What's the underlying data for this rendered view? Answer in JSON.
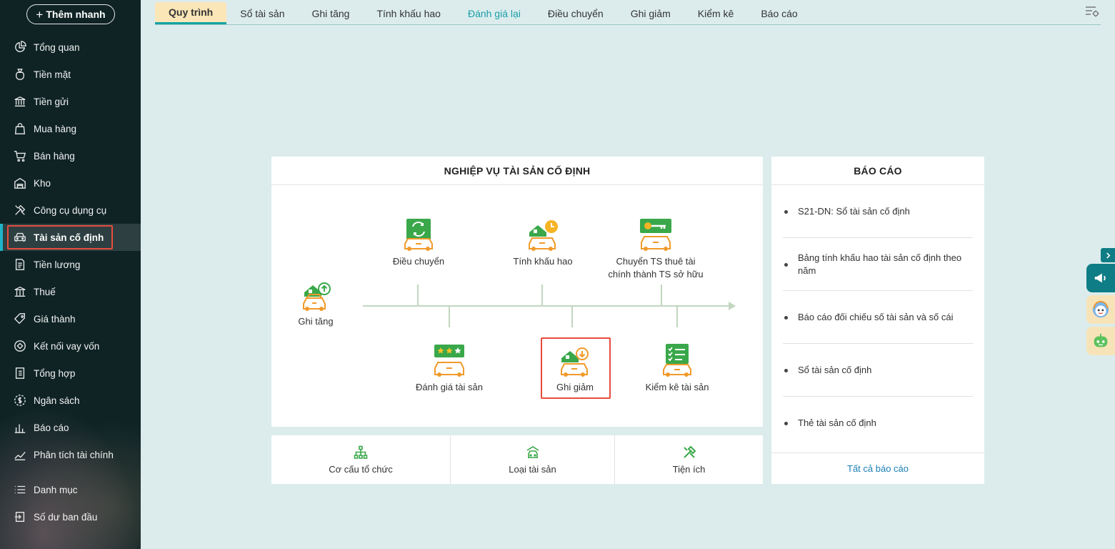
{
  "sidebar": {
    "quick_add": "Thêm nhanh",
    "items": [
      {
        "label": "Tổng quan",
        "icon": "pie-chart-icon"
      },
      {
        "label": "Tiền mặt",
        "icon": "money-bag-icon"
      },
      {
        "label": "Tiền gửi",
        "icon": "bank-icon"
      },
      {
        "label": "Mua hàng",
        "icon": "shopping-bag-icon"
      },
      {
        "label": "Bán hàng",
        "icon": "cart-icon"
      },
      {
        "label": "Kho",
        "icon": "warehouse-icon"
      },
      {
        "label": "Công cụ dụng cụ",
        "icon": "tools-icon"
      },
      {
        "label": "Tài sản cố định",
        "icon": "car-icon",
        "active": true
      },
      {
        "label": "Tiền lương",
        "icon": "payroll-icon"
      },
      {
        "label": "Thuế",
        "icon": "tax-building-icon"
      },
      {
        "label": "Giá thành",
        "icon": "price-tag-icon"
      },
      {
        "label": "Kết nối vay vốn",
        "icon": "loan-link-icon"
      },
      {
        "label": "Tổng hợp",
        "icon": "ledger-icon"
      },
      {
        "label": "Ngân sách",
        "icon": "budget-coin-icon"
      },
      {
        "label": "Báo cáo",
        "icon": "bar-chart-icon"
      },
      {
        "label": "Phân tích tài chính",
        "icon": "trend-line-icon"
      }
    ],
    "bottom_items": [
      {
        "label": "Danh mục",
        "icon": "list-icon"
      },
      {
        "label": "Số dư ban đầu",
        "icon": "opening-balance-icon"
      }
    ]
  },
  "tabs": [
    {
      "label": "Quy trình",
      "active": true
    },
    {
      "label": "Sổ tài sản"
    },
    {
      "label": "Ghi tăng"
    },
    {
      "label": "Tính khấu hao"
    },
    {
      "label": "Đánh giá lại",
      "highlight": true
    },
    {
      "label": "Điều chuyển"
    },
    {
      "label": "Ghi giảm"
    },
    {
      "label": "Kiểm kê"
    },
    {
      "label": "Báo cáo"
    }
  ],
  "process": {
    "title": "NGHIỆP VỤ TÀI SẢN CỐ ĐỊNH",
    "steps": {
      "ghi_tang": "Ghi tăng",
      "dieu_chuyen": "Điều chuyển",
      "tinh_khau_hao": "Tính khấu hao",
      "chuyen_ts_line1": "Chuyển TS thuê tài",
      "chuyen_ts_line2": "chính thành TS sở hữu",
      "danh_gia": "Đánh giá tài sản",
      "ghi_giam": "Ghi giảm",
      "kiem_ke": "Kiểm kê tài sản"
    },
    "selected_step": "Ghi giảm"
  },
  "shortcuts": [
    {
      "label": "Cơ cấu tổ chức",
      "icon": "org-chart-icon"
    },
    {
      "label": "Loại tài sản",
      "icon": "garage-icon"
    },
    {
      "label": "Tiện ích",
      "icon": "utility-tools-icon"
    }
  ],
  "reports": {
    "title": "BÁO CÁO",
    "items": [
      "S21-DN: Sổ tài sản cố định",
      "Bảng tính khấu hao tài sản cố định theo năm",
      "Báo cáo đối chiếu số tài sản và số cái",
      "Sổ tài sản cố định",
      "Thẻ tài sản cố định"
    ],
    "all_link": "Tất cả báo cáo"
  },
  "colors": {
    "sidebar_bg": "#0f2325",
    "page_bg": "#dceced",
    "accent_teal": "#13a3a3",
    "tab_active_bg": "#fbe6b8",
    "icon_green": "#3aa84a",
    "icon_orange": "#f09a2a",
    "highlight_red": "#e74c3c"
  }
}
